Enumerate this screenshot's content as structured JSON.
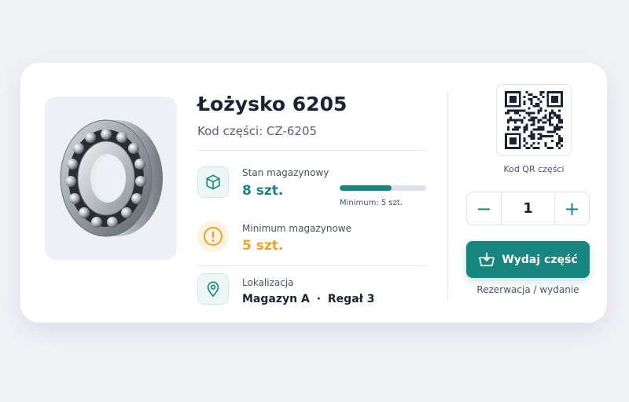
{
  "product": {
    "title": "Łożysko 6205",
    "code_label": "Kod części: CZ-6205",
    "image_alt": "ball-bearing"
  },
  "stock": {
    "label": "Stan magazynowy",
    "value": "8 szt.",
    "fill_fraction": 0.6,
    "minimum_caption": "Minimum: 5 szt.",
    "icon": "box-icon"
  },
  "minimum": {
    "label": "Minimum magazynowe",
    "value": "5 szt.",
    "icon": "warning-icon"
  },
  "location": {
    "label": "Lokalizacja",
    "warehouse": "Magazyn A",
    "separator": "·",
    "shelf": "Regał 3",
    "icon": "map-pin-icon"
  },
  "qr": {
    "caption": "Kod QR części",
    "icon": "qr-code-icon"
  },
  "quantity": {
    "decrement": "−",
    "value": "1",
    "increment": "+"
  },
  "issue": {
    "button_label": "Wydaj część",
    "caption": "Rezerwacja / wydanie",
    "icon": "basket-icon"
  },
  "colors": {
    "accent": "#16867e",
    "warning": "#f0a322",
    "text": "#1c2233",
    "muted": "#5b6170"
  }
}
